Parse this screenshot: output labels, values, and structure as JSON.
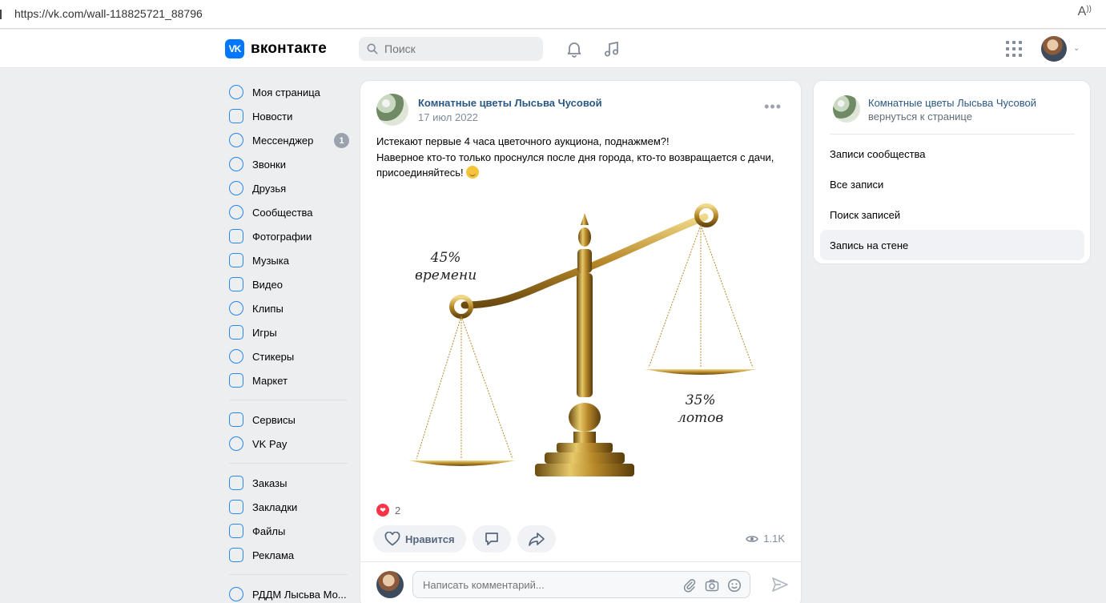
{
  "browser": {
    "url": "https://vk.com/wall-118825721_88796",
    "reader_icon": "A͘"
  },
  "header": {
    "logo_mark": "VK",
    "logo_text": "вконтакте",
    "search_placeholder": "Поиск",
    "icons": [
      "bell-icon",
      "music-icon",
      "apps-grid-icon",
      "avatar",
      "chevron-down-icon"
    ]
  },
  "sidebar": {
    "items": [
      {
        "label": "Моя страница",
        "icon": "user-circle-icon"
      },
      {
        "label": "Новости",
        "icon": "news-icon"
      },
      {
        "label": "Мессенджер",
        "icon": "message-icon",
        "badge": "1"
      },
      {
        "label": "Звонки",
        "icon": "phone-icon"
      },
      {
        "label": "Друзья",
        "icon": "friends-icon"
      },
      {
        "label": "Сообщества",
        "icon": "communities-icon"
      },
      {
        "label": "Фотографии",
        "icon": "photo-icon"
      },
      {
        "label": "Музыка",
        "icon": "music-icon"
      },
      {
        "label": "Видео",
        "icon": "video-icon"
      },
      {
        "label": "Клипы",
        "icon": "clips-icon"
      },
      {
        "label": "Игры",
        "icon": "gamepad-icon"
      },
      {
        "label": "Стикеры",
        "icon": "smile-icon"
      },
      {
        "label": "Маркет",
        "icon": "bag-icon"
      }
    ],
    "items2": [
      {
        "label": "Сервисы",
        "icon": "services-icon"
      },
      {
        "label": "VK Pay",
        "icon": "vkpay-icon"
      }
    ],
    "items3": [
      {
        "label": "Заказы",
        "icon": "box-icon"
      },
      {
        "label": "Закладки",
        "icon": "bookmark-icon"
      },
      {
        "label": "Файлы",
        "icon": "file-icon"
      },
      {
        "label": "Реклама",
        "icon": "megaphone-icon"
      }
    ],
    "items4": [
      {
        "label": "РДДМ Лысьва Мо...",
        "icon": "group-icon"
      }
    ]
  },
  "post": {
    "group_name": "Комнатные цветы Лысьва Чусовой",
    "date": "17 июл 2022",
    "text_lines": [
      "Истекают первые 4 часа цветочного аукциона, поднажмем?!",
      "Наверное кто-то только проснулся после дня города, кто-то возвращается с дачи,",
      "присоединяйтесь!"
    ],
    "image": {
      "label_left_1": "45%",
      "label_left_2": "времени",
      "label_right_1": "35%",
      "label_right_2": "лотов"
    },
    "likes_count": "2",
    "like_label": "Нравится",
    "views": "1.1K",
    "comment_placeholder": "Написать комментарий..."
  },
  "right_panel": {
    "group_name": "Комнатные цветы Лысьва Чусовой",
    "back_label": "вернуться к странице",
    "menu": [
      {
        "label": "Записи сообщества",
        "active": false
      },
      {
        "label": "Все записи",
        "active": false
      },
      {
        "label": "Поиск записей",
        "active": false
      },
      {
        "label": "Запись на стене",
        "active": true
      }
    ]
  },
  "colors": {
    "accent": "#2688eb",
    "brand": "#0077ff",
    "link": "#2a5885",
    "bg": "#edeef0",
    "like": "#ff3347"
  }
}
